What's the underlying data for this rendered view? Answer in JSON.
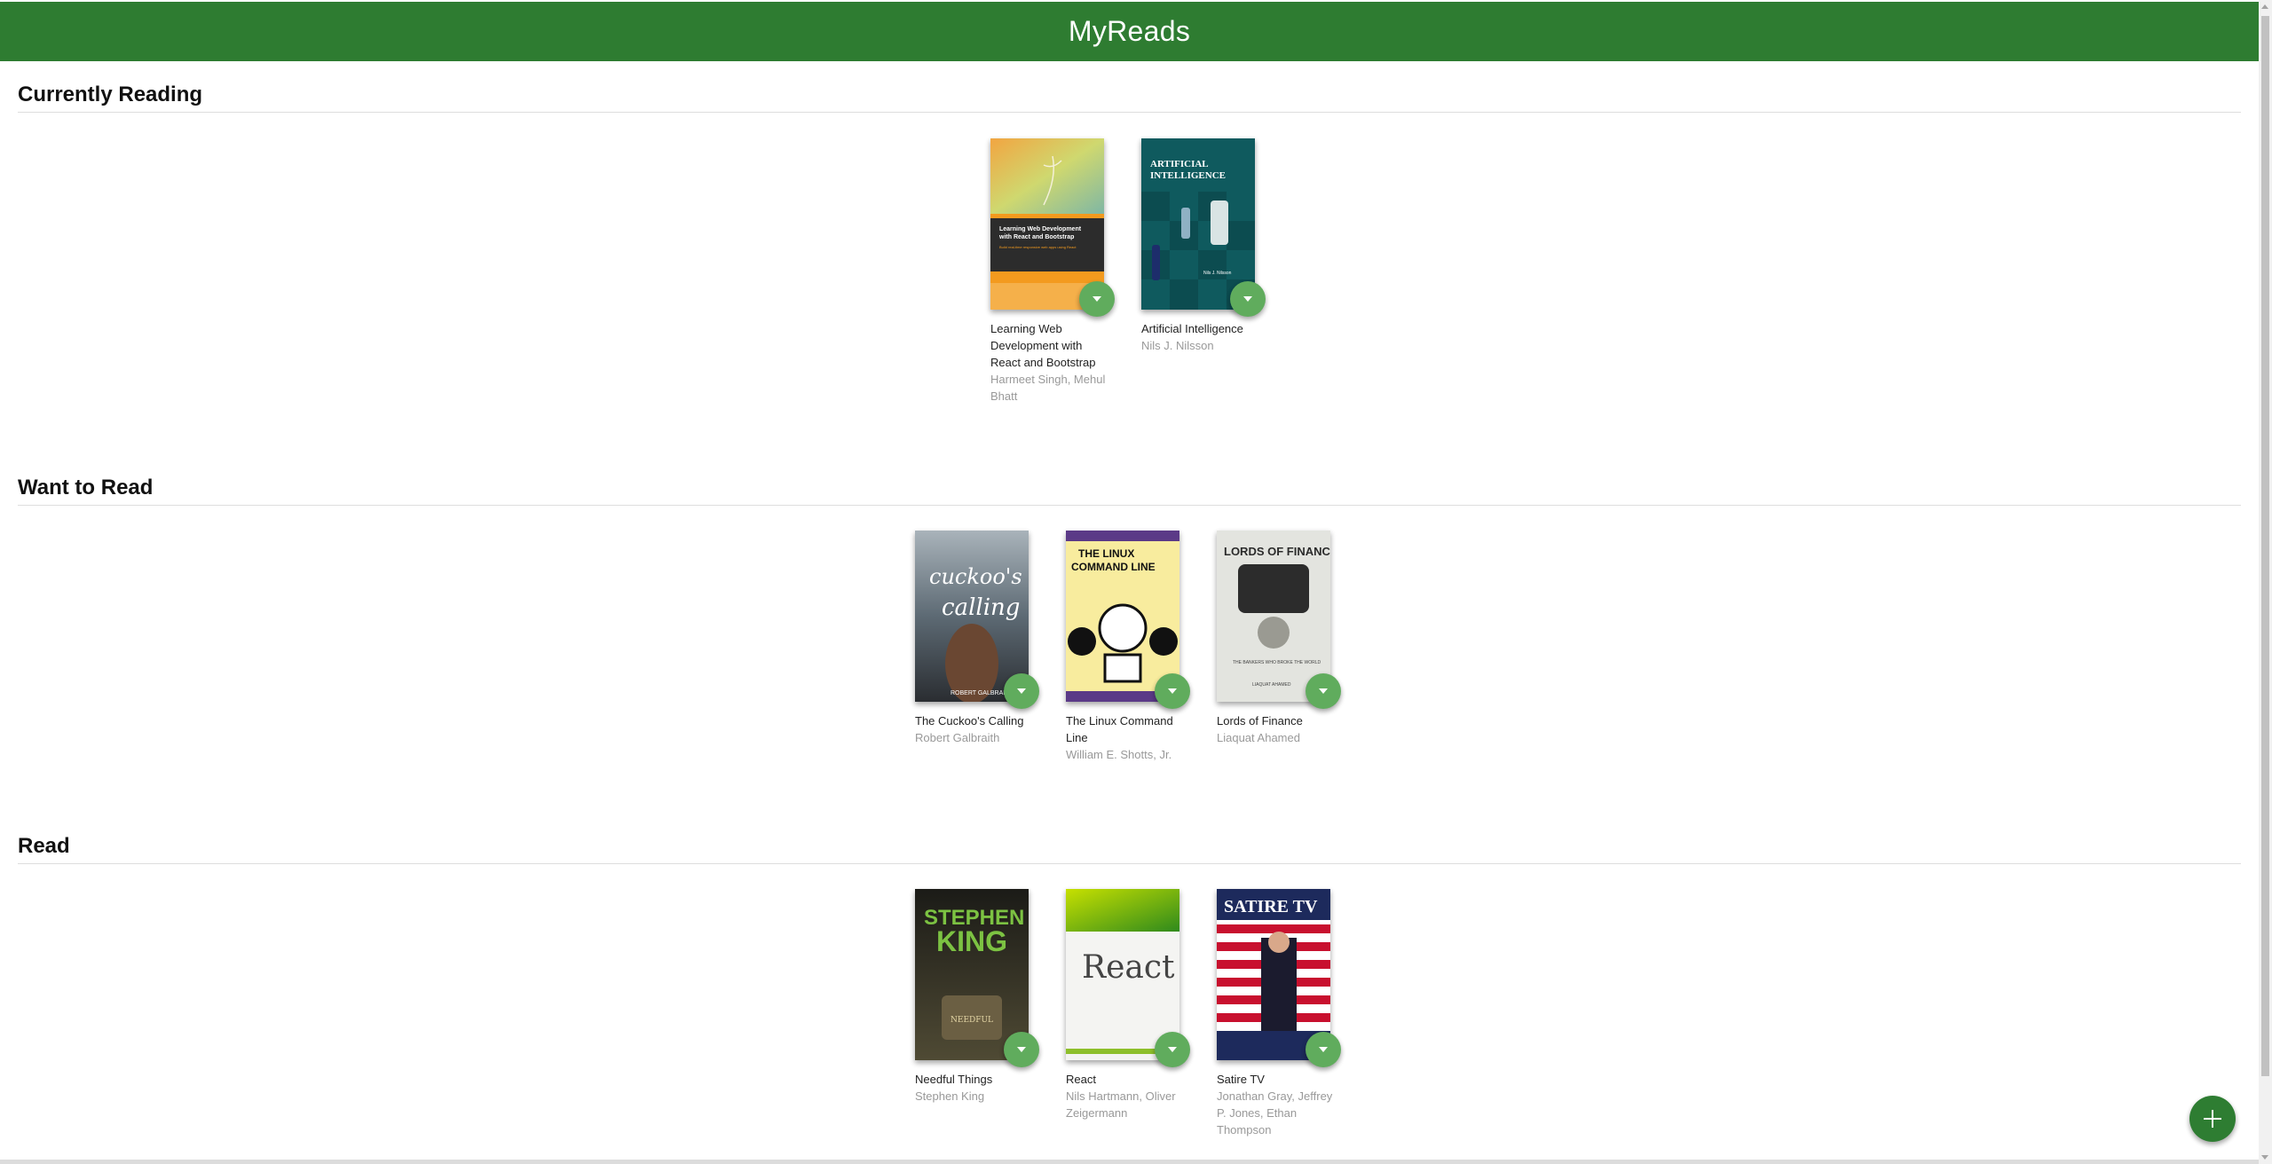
{
  "app": {
    "title": "MyReads"
  },
  "shelves": [
    {
      "title": "Currently Reading",
      "books": [
        {
          "title": "Learning Web Development with React and Bootstrap",
          "authors": "Harmeet Singh, Mehul Bhatt",
          "cover_text": "Learning Web Development with React and Bootstrap"
        },
        {
          "title": "Artificial Intelligence",
          "authors": "Nils J. Nilsson",
          "cover_text": "ARTIFICIAL INTELLIGENCE"
        }
      ]
    },
    {
      "title": "Want to Read",
      "books": [
        {
          "title": "The Cuckoo's Calling",
          "authors": "Robert Galbraith",
          "cover_text": "cuckoo's calling"
        },
        {
          "title": "The Linux Command Line",
          "authors": "William E. Shotts, Jr.",
          "cover_text": "THE LINUX COMMAND LINE"
        },
        {
          "title": "Lords of Finance",
          "authors": "Liaquat Ahamed",
          "cover_text": "LORDS OF FINANCE"
        }
      ]
    },
    {
      "title": "Read",
      "books": [
        {
          "title": "Needful Things",
          "authors": "Stephen King",
          "cover_text": "STEPHEN KING"
        },
        {
          "title": "React",
          "authors": "Nils Hartmann, Oliver Zeigermann",
          "cover_text": "React"
        },
        {
          "title": "Satire TV",
          "authors": "Jonathan Gray, Jeffrey P. Jones, Ethan Thompson",
          "cover_text": "SATIRE TV"
        }
      ]
    }
  ],
  "colors": {
    "header": "#2e7c31",
    "shelf_changer": "#60ac5d",
    "add_button": "#2e7d32"
  },
  "icons": {
    "shelf_changer": "caret-down-icon",
    "add": "plus-icon"
  }
}
